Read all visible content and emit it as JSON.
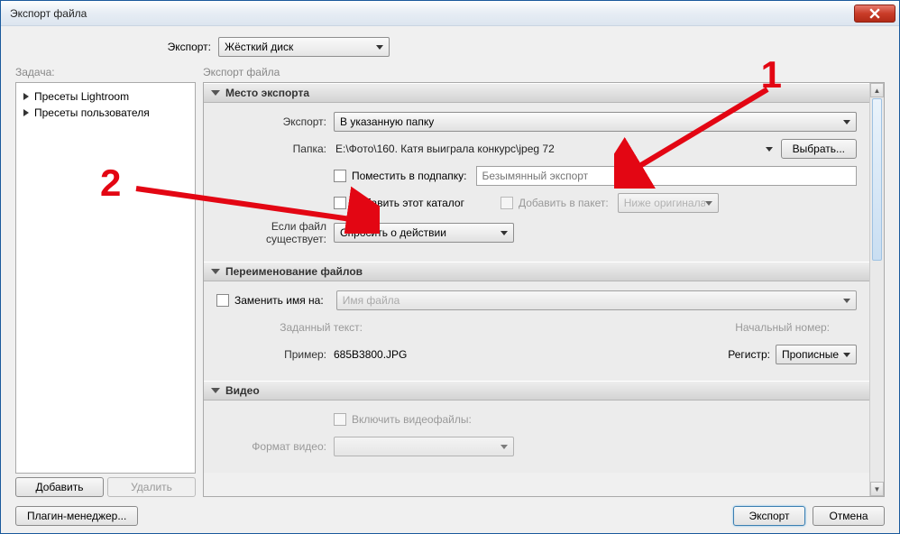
{
  "window": {
    "title": "Экспорт файла"
  },
  "top": {
    "label": "Экспорт:",
    "value": "Жёсткий диск"
  },
  "task": {
    "label": "Задача:",
    "presets": [
      "Пресеты Lightroom",
      "Пресеты пользователя"
    ],
    "add": "Добавить",
    "remove": "Удалить"
  },
  "right_label": "Экспорт файла",
  "sections": {
    "location": {
      "title": "Место экспорта",
      "export_label": "Экспорт:",
      "export_value": "В указанную папку",
      "folder_label": "Папка:",
      "folder_value": "E:\\Фото\\160. Катя выиграла конкурс\\jpeg 72",
      "choose": "Выбрать...",
      "put_sub": "Поместить в подпапку:",
      "sub_placeholder": "Безымянный экспорт",
      "add_catalog": "Добавить этот каталог",
      "add_packet": "Добавить в пакет:",
      "packet_value": "Ниже оригинала",
      "exists_label": "Если файл существует:",
      "exists_value": "Спросить о действии"
    },
    "rename": {
      "title": "Переименование файлов",
      "replace": "Заменить имя на:",
      "filename_placeholder": "Имя файла",
      "custom_text": "Заданный текст:",
      "start_num": "Начальный номер:",
      "example_label": "Пример:",
      "example_value": "685B3800.JPG",
      "case_label": "Регистр:",
      "case_value": "Прописные"
    },
    "video": {
      "title": "Видео",
      "include": "Включить видеофайлы:",
      "format_label": "Формат видео:"
    }
  },
  "footer": {
    "plugin": "Плагин-менеджер...",
    "export": "Экспорт",
    "cancel": "Отмена"
  },
  "annotations": {
    "one": "1",
    "two": "2"
  }
}
